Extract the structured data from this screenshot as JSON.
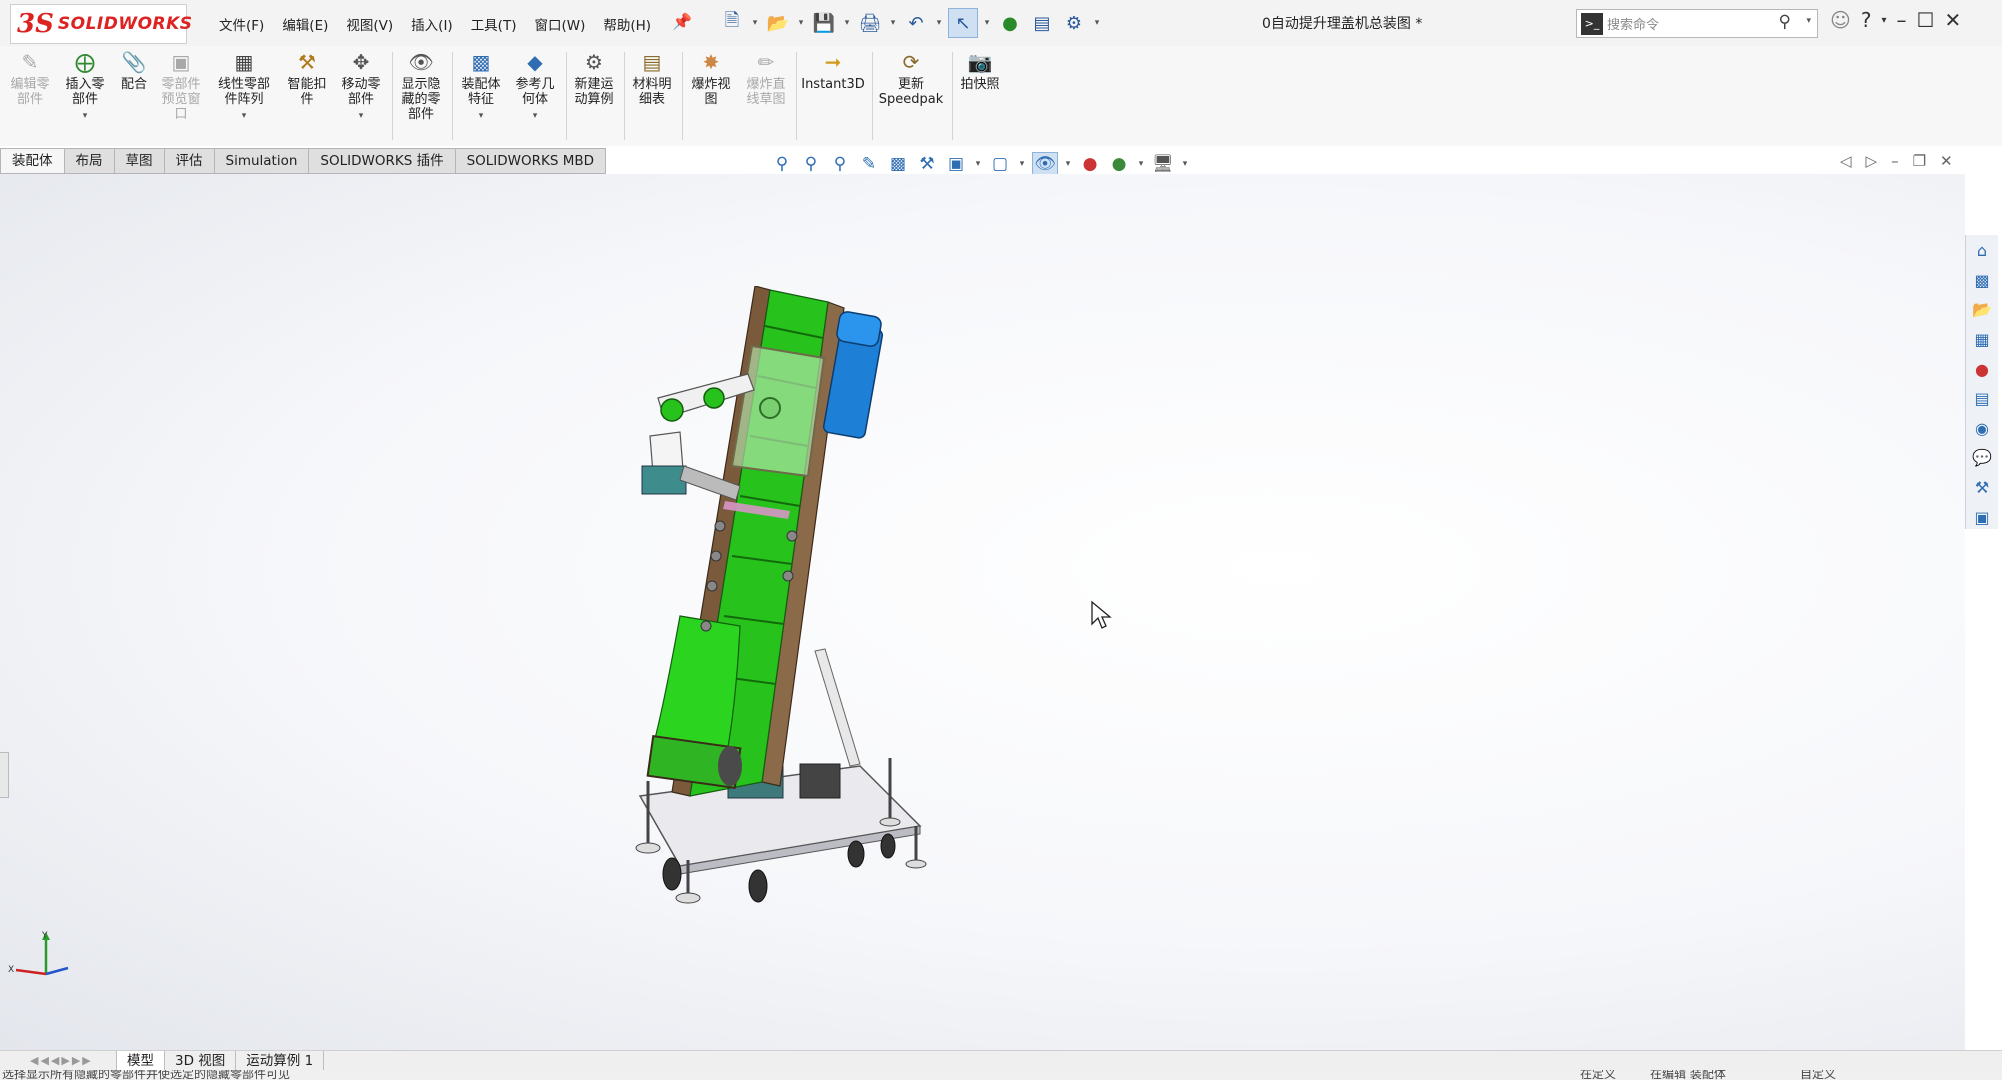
{
  "app": {
    "logo_ds": "3S",
    "logo_text": "SOLIDWORKS",
    "document_title": "0自动提升理盖机总装图 *"
  },
  "menu": [
    "文件(F)",
    "编辑(E)",
    "视图(V)",
    "插入(I)",
    "工具(T)",
    "窗口(W)",
    "帮助(H)"
  ],
  "search": {
    "placeholder": "搜索命令"
  },
  "commands": [
    {
      "label": "编辑零\n部件",
      "disabled": true
    },
    {
      "label": "插入零\n部件",
      "disabled": false
    },
    {
      "label": "配合",
      "disabled": false
    },
    {
      "label": "零部件\n预览窗\n口",
      "disabled": true
    },
    {
      "label": "线性零部\n件阵列",
      "disabled": false
    },
    {
      "label": "智能扣\n件",
      "disabled": false
    },
    {
      "label": "移动零\n部件",
      "disabled": false
    },
    {
      "label": "显示隐\n藏的零\n部件",
      "disabled": false
    },
    {
      "label": "装配体\n特征",
      "disabled": false
    },
    {
      "label": "参考几\n何体",
      "disabled": false
    },
    {
      "label": "新建运\n动算例",
      "disabled": false
    },
    {
      "label": "材料明\n细表",
      "disabled": false
    },
    {
      "label": "爆炸视\n图",
      "disabled": false
    },
    {
      "label": "爆炸直\n线草图",
      "disabled": true
    },
    {
      "label": "Instant3D",
      "disabled": false
    },
    {
      "label": "更新\nSpeedpak",
      "disabled": false
    },
    {
      "label": "拍快照",
      "disabled": false
    }
  ],
  "tabs": [
    "装配体",
    "布局",
    "草图",
    "评估",
    "Simulation",
    "SOLIDWORKS 插件",
    "SOLIDWORKS MBD"
  ],
  "bottom_tabs": [
    "模型",
    "3D 视图",
    "运动算例 1"
  ],
  "status": {
    "left": "选择显示所有隐藏的零部件并使选定的隐藏零部件可见",
    "right1": "在定义",
    "right2": "在编辑 装配体",
    "right3": "自定义"
  },
  "triad": {
    "x_label": "X",
    "y_label": "Y"
  },
  "colors": {
    "belt": "#27c21c",
    "frame": "#7a5a3a",
    "motor": "#1e7fd6",
    "base": "#e6e6ea",
    "accent_red": "#d22222"
  }
}
